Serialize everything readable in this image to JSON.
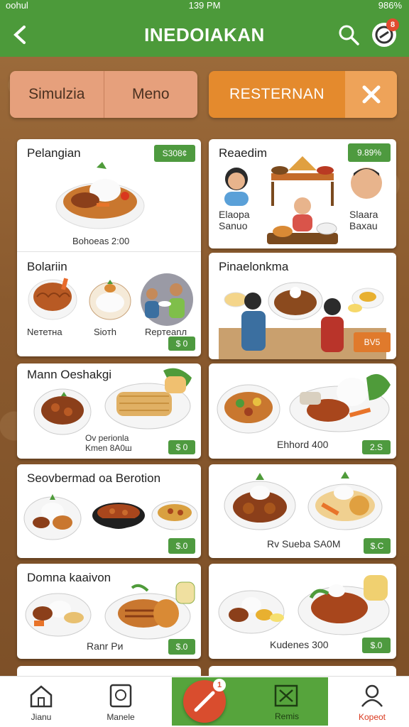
{
  "status": {
    "carrier": "ᴏᴏhul",
    "time": "139 PM",
    "battery": "986%"
  },
  "header": {
    "title": "INEDOIAKAN",
    "badge": "8"
  },
  "filters": {
    "seg_left": "Simulzia",
    "seg_right": "Meno",
    "resto": "RESTERNAN"
  },
  "cards": [
    {
      "title": "Pelangian",
      "price": "S308¢",
      "caption": "Bohoeas 2:00"
    },
    {
      "title": "Reaedim",
      "price": "9.89%",
      "caption_left": "Elaора Sanuo",
      "caption_right": "Slaara Baxau"
    },
    {
      "title": "Bolariin",
      "price": "$ 0",
      "cap1": "Neтетна",
      "cap2": "Sioтh",
      "cap3": "Repтeanл"
    },
    {
      "title": "Pinaelonkma",
      "price": "BV5"
    },
    {
      "title": "Mann Oeshakgi",
      "price": "$ 0",
      "caption": "Ov perionla Kmen 8A0ш"
    },
    {
      "title": "",
      "price": "2.S",
      "caption": "Ehhord 400"
    },
    {
      "title": "Seovbermad oa Berotion",
      "price": "$.0",
      "caption": ""
    },
    {
      "title": "",
      "price": "$.C",
      "caption": "Rv Sueba SA0M"
    },
    {
      "title": "Domna kaaivon",
      "price": "$.0",
      "caption": "Ranr Pи"
    },
    {
      "title": "",
      "price": "$.0",
      "caption": "Kudenes 300"
    }
  ],
  "nav": {
    "item1": "Jianu",
    "item2": "Manele",
    "fab_badge": "1",
    "item4": "Remis",
    "item5": "Kopeot"
  },
  "colors": {
    "primary": "#4c9a3a",
    "accent": "#e48a2d",
    "price": "#4e9a3f"
  }
}
